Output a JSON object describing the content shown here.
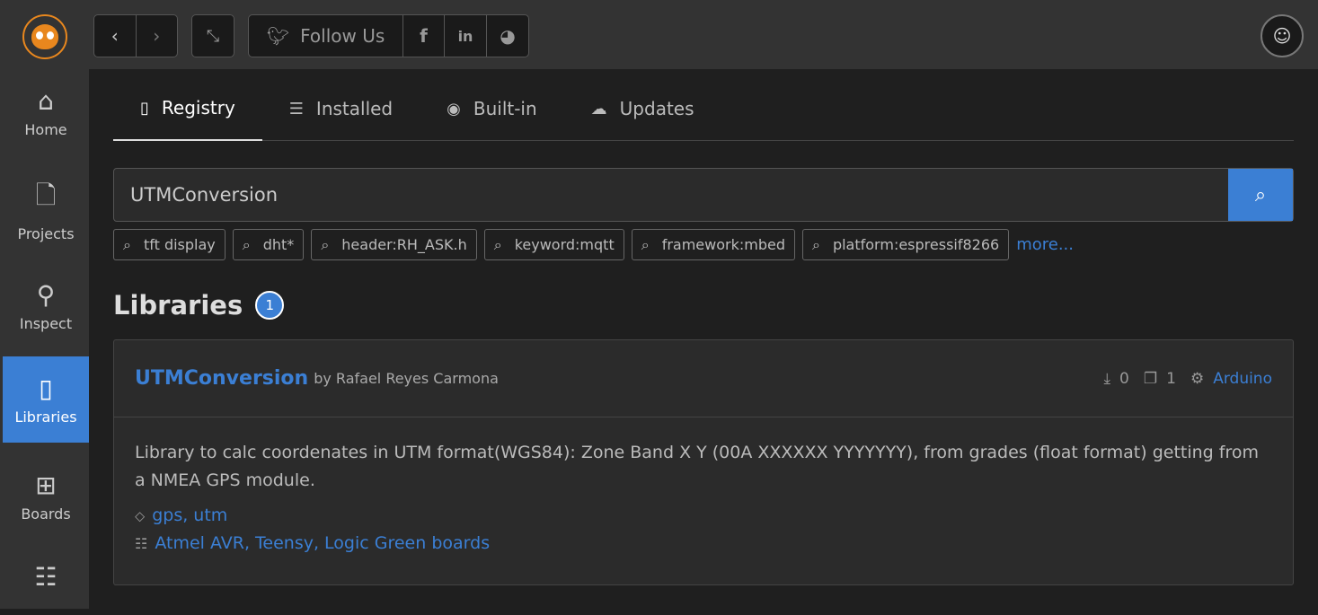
{
  "toolbar": {
    "follow_label": "Follow Us"
  },
  "sidebar": {
    "items": [
      {
        "label": "Home",
        "icon": "home-icon"
      },
      {
        "label": "Projects",
        "icon": "project-icon"
      },
      {
        "label": "Inspect",
        "icon": "inspect-icon"
      },
      {
        "label": "Libraries",
        "icon": "book-icon",
        "active": true
      },
      {
        "label": "Boards",
        "icon": "calculator-icon"
      }
    ]
  },
  "tabs": [
    {
      "label": "Registry"
    },
    {
      "label": "Installed"
    },
    {
      "label": "Built-in"
    },
    {
      "label": "Updates"
    }
  ],
  "search": {
    "value": "UTMConversion"
  },
  "chips": [
    "tft display",
    "dht*",
    "header:RH_ASK.h",
    "keyword:mqtt",
    "framework:mbed",
    "platform:espressif8266"
  ],
  "more": "more...",
  "section": {
    "title": "Libraries",
    "count": "1"
  },
  "library": {
    "name": "UTMConversion",
    "author": "by Rafael Reyes Carmona",
    "downloads": "0",
    "examples": "1",
    "framework": "Arduino",
    "description": "Library to calc coordenates in UTM format(WGS84): Zone Band X Y (00A XXXXXX YYYYYYY), from grades (float format) getting from a NMEA GPS module.",
    "keywords": "gps, utm",
    "boards": "Atmel AVR, Teensy, Logic Green boards"
  },
  "colors": {
    "accent": "#3b7fd4",
    "logo": "#e8871e"
  }
}
